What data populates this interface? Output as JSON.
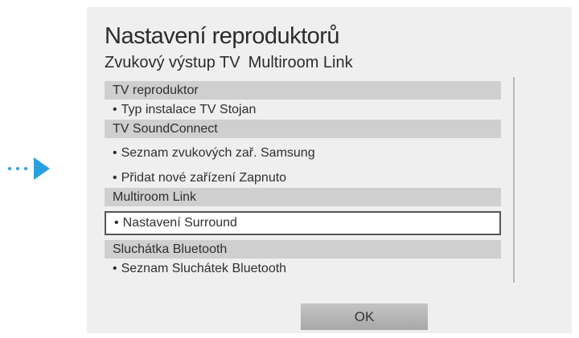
{
  "dialog": {
    "title": "Nastavení reproduktorů",
    "tabs": [
      "Zvukový výstup TV",
      "Multiroom Link"
    ]
  },
  "menu": {
    "sections": [
      {
        "header": "TV reproduktor",
        "items": [
          "Typ instalace TV Stojan"
        ]
      },
      {
        "header": "TV SoundConnect",
        "items": [
          "Seznam zvukových zař. Samsung",
          "Přidat nové zařízení Zapnuto"
        ]
      },
      {
        "header": "Multiroom Link",
        "items": [
          "Nastavení Surround"
        ]
      },
      {
        "header": "Sluchátka Bluetooth",
        "items": [
          "Seznam Sluchátek Bluetooth"
        ]
      }
    ],
    "bullet": "•"
  },
  "ok_label": "OK",
  "colors": {
    "accent": "#2a9fe0",
    "panel": "#efefef",
    "section_header": "#cfcfcf",
    "selection_border": "#555555"
  },
  "icons": {
    "pointer": "arrow-pointer-icon"
  }
}
